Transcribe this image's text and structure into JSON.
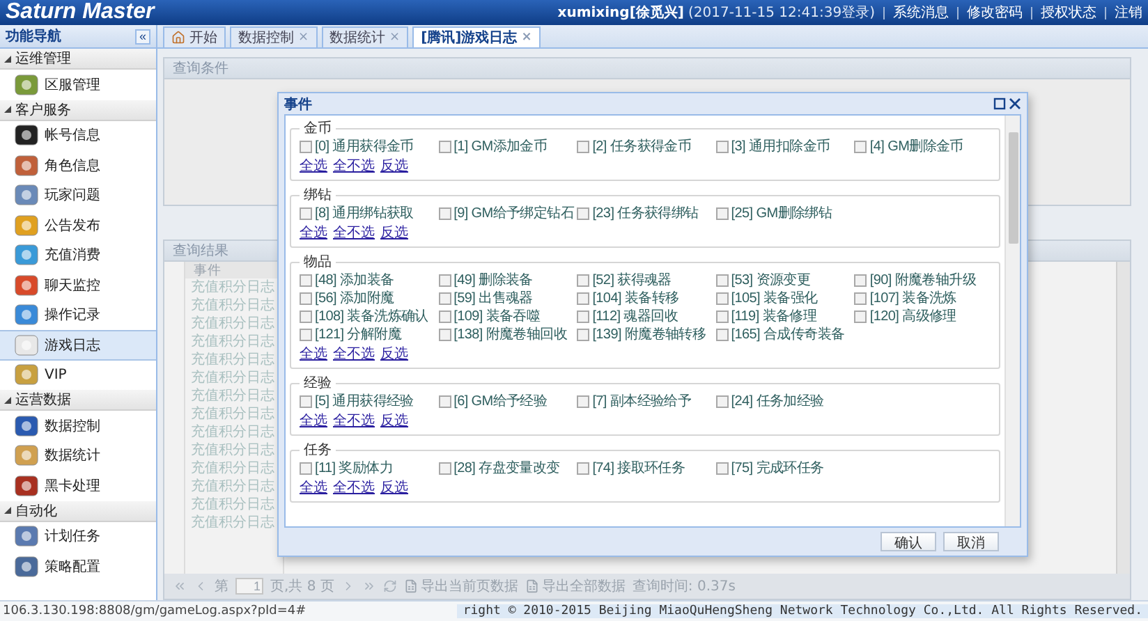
{
  "header": {
    "title": "Saturn Master",
    "user": "xumixing[徐觅兴]",
    "login": "(2017-11-15 12:41:39登录)",
    "links": [
      "系统消息",
      "修改密码",
      "授权状态",
      "注销"
    ]
  },
  "sidebar": {
    "title": "功能导航",
    "collapse": "«",
    "groups": [
      {
        "label": "运维管理",
        "expanded": true,
        "items": [
          {
            "label": "区服管理",
            "selected": false
          }
        ]
      },
      {
        "label": "客户服务",
        "expanded": true,
        "items": [
          {
            "label": "帐号信息",
            "selected": false
          },
          {
            "label": "角色信息",
            "selected": false
          },
          {
            "label": "玩家问题",
            "selected": false
          },
          {
            "label": "公告发布",
            "selected": false
          },
          {
            "label": "充值消费",
            "selected": false
          },
          {
            "label": "聊天监控",
            "selected": false
          },
          {
            "label": "操作记录",
            "selected": false
          },
          {
            "label": "游戏日志",
            "selected": true
          },
          {
            "label": "VIP",
            "selected": false
          }
        ]
      },
      {
        "label": "运营数据",
        "expanded": true,
        "items": [
          {
            "label": "数据控制",
            "selected": false
          },
          {
            "label": "数据统计",
            "selected": false
          },
          {
            "label": "黑卡处理",
            "selected": false
          }
        ]
      },
      {
        "label": "自动化",
        "expanded": true,
        "items": [
          {
            "label": "计划任务",
            "selected": false
          },
          {
            "label": "策略配置",
            "selected": false
          }
        ]
      }
    ]
  },
  "tabs": [
    {
      "label": "开始",
      "selected": false,
      "kind": "home"
    },
    {
      "label": "数据控制",
      "selected": false,
      "kind": "page",
      "close": "×"
    },
    {
      "label": "数据统计",
      "selected": false,
      "kind": "page",
      "close": "×"
    },
    {
      "label": "[腾讯]游戏日志",
      "selected": true,
      "kind": "page",
      "close": "×"
    }
  ],
  "query_panel": {
    "title": "查询条件"
  },
  "results": {
    "title": "查询结果",
    "columns": [
      "事件"
    ],
    "rows": [
      "充值积分日志",
      "充值积分日志",
      "充值积分日志",
      "充值积分日志",
      "充值积分日志",
      "充值积分日志",
      "充值积分日志",
      "充值积分日志",
      "充值积分日志",
      "充值积分日志",
      "充值积分日志",
      "充值积分日志",
      "充值积分日志",
      "充值积分日志"
    ]
  },
  "pager": {
    "page_prefix": "第",
    "page": "1",
    "page_suffix": "页,共 8 页",
    "export_page": "导出当前页数据",
    "export_all": "导出全部数据",
    "query_time": "查询时间: 0.37s"
  },
  "dialog": {
    "title": "事件",
    "sections": [
      {
        "legend": "金币",
        "options": [
          {
            "label": "[0] 通用获得金币",
            "checked": false
          },
          {
            "label": "[1] GM添加金币",
            "checked": false
          },
          {
            "label": "[2] 任务获得金币",
            "checked": false
          },
          {
            "label": "[3] 通用扣除金币",
            "checked": false
          },
          {
            "label": "[4] GM删除金币",
            "checked": false
          }
        ],
        "actions": [
          "全选",
          "全不选",
          "反选"
        ]
      },
      {
        "legend": "绑钻",
        "options": [
          {
            "label": "[8] 通用绑钻获取",
            "checked": false
          },
          {
            "label": "[9] GM给予绑定钻石",
            "checked": false
          },
          {
            "label": "[23] 任务获得绑钻",
            "checked": false
          },
          {
            "label": "[25] GM删除绑钻",
            "checked": false
          }
        ],
        "actions": [
          "全选",
          "全不选",
          "反选"
        ]
      },
      {
        "legend": "物品",
        "options": [
          {
            "label": "[48] 添加装备",
            "checked": false
          },
          {
            "label": "[49] 删除装备",
            "checked": false
          },
          {
            "label": "[52] 获得魂器",
            "checked": false
          },
          {
            "label": "[53] 资源变更",
            "checked": false
          },
          {
            "label": "[90] 附魔卷轴升级",
            "checked": false
          },
          {
            "label": "[56] 添加附魔",
            "checked": false
          },
          {
            "label": "[59] 出售魂器",
            "checked": false
          },
          {
            "label": "[104] 装备转移",
            "checked": false
          },
          {
            "label": "[105] 装备强化",
            "checked": false
          },
          {
            "label": "[107] 装备洗炼",
            "checked": false
          },
          {
            "label": "[108] 装备洗炼确认",
            "checked": false
          },
          {
            "label": "[109] 装备吞噬",
            "checked": false
          },
          {
            "label": "[112] 魂器回收",
            "checked": false
          },
          {
            "label": "[119] 装备修理",
            "checked": false
          },
          {
            "label": "[120] 高级修理",
            "checked": false
          },
          {
            "label": "[121] 分解附魔",
            "checked": false
          },
          {
            "label": "[138] 附魔卷轴回收",
            "checked": false
          },
          {
            "label": "[139] 附魔卷轴转移",
            "checked": false
          },
          {
            "label": "[165] 合成传奇装备",
            "checked": false
          }
        ],
        "actions": [
          "全选",
          "全不选",
          "反选"
        ]
      },
      {
        "legend": "经验",
        "options": [
          {
            "label": "[5] 通用获得经验",
            "checked": false
          },
          {
            "label": "[6] GM给予经验",
            "checked": false
          },
          {
            "label": "[7] 副本经验给予",
            "checked": false
          },
          {
            "label": "[24] 任务加经验",
            "checked": false
          }
        ],
        "actions": [
          "全选",
          "全不选",
          "反选"
        ]
      },
      {
        "legend": "任务",
        "options": [
          {
            "label": "[11] 奖励体力",
            "checked": false
          },
          {
            "label": "[28] 存盘变量改变",
            "checked": false
          },
          {
            "label": "[74] 接取环任务",
            "checked": false
          },
          {
            "label": "[75] 完成环任务",
            "checked": false
          }
        ],
        "actions": [
          "全选",
          "全不选",
          "反选"
        ]
      }
    ],
    "buttons": [
      "确认",
      "取消"
    ]
  },
  "status_bar": {
    "url": "106.3.130.198:8808/gm/gameLog.aspx?pId=4#",
    "copyright": "right © 2010-2015 Beijing MiaoQuHengSheng Network Technology Co.,Ltd. All Rights Reserved."
  }
}
